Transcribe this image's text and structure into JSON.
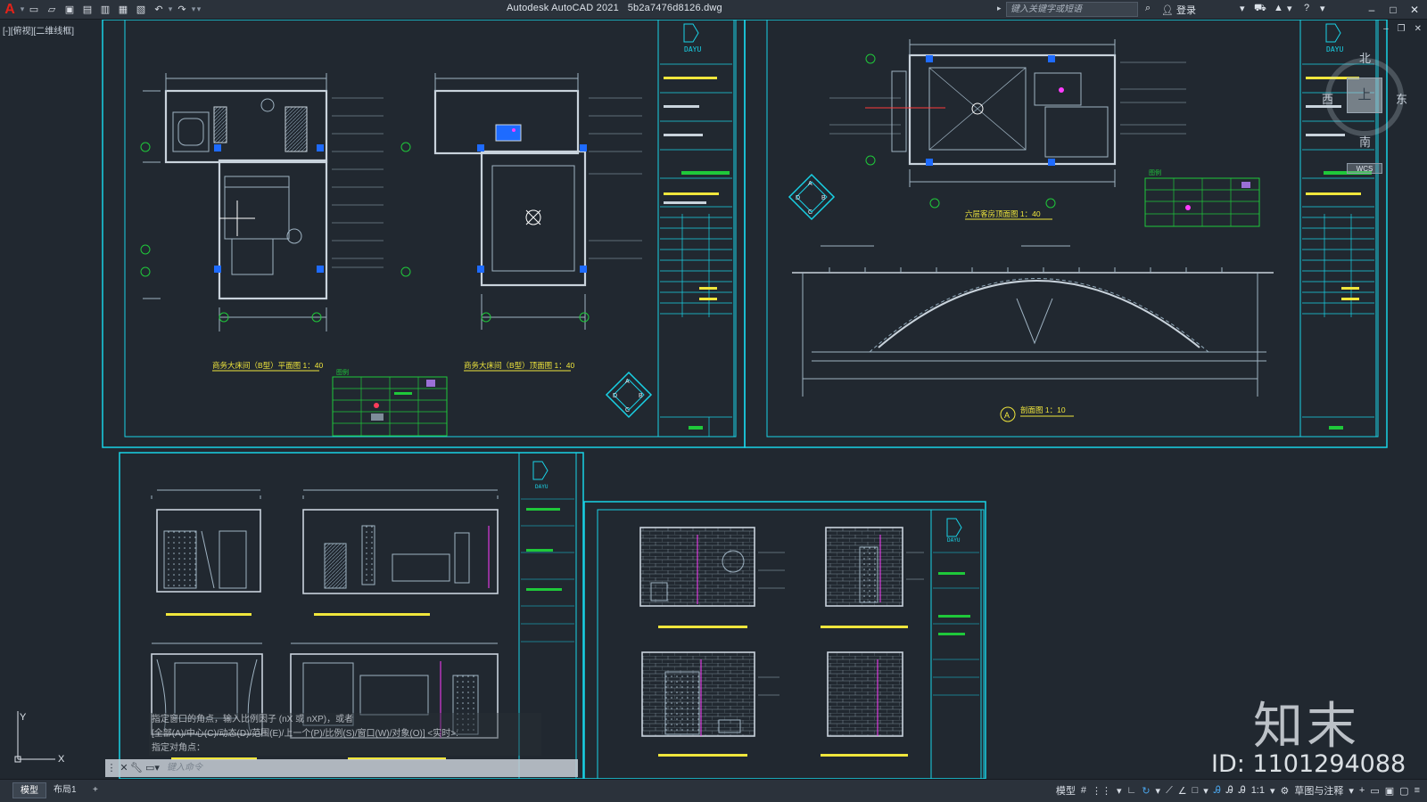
{
  "app": {
    "title": "Autodesk AutoCAD 2021",
    "filename": "5b2a7476d8126.dwg",
    "logo_letter": "A"
  },
  "search": {
    "placeholder": "键入关键字或短语"
  },
  "user": {
    "login_label": "登录"
  },
  "viewport": {
    "label": "[-][俯视][二维线框]"
  },
  "viewcube": {
    "face": "上",
    "north": "北",
    "south": "南",
    "east": "东",
    "west": "西",
    "wcs": "WCS"
  },
  "ucs": {
    "x": "X",
    "y": "Y"
  },
  "sheets": {
    "top_left": {
      "plan_title": "商务大床间（B型）平面图 1：40",
      "ceiling_title": "商务大床间（B型）顶面图 1：40",
      "legend_title": "图例",
      "firm": "DAYU"
    },
    "top_right": {
      "plan_title": "六层客房顶面图 1：40",
      "section_title": "剖面图 1：10",
      "section_marker": "A",
      "legend_title": "图例",
      "firm": "DAYU"
    },
    "bottom_left": {
      "firm": "DAYU"
    },
    "bottom_right": {
      "firm": "DAYU"
    }
  },
  "command": {
    "history": [
      "指定窗口的角点，输入比例因子 (nX 或 nXP)，或者",
      "[全部(A)/中心(C)/动态(D)/范围(E)/上一个(P)/比例(S)/窗口(W)/对象(O)] <实时>:",
      "指定对角点："
    ],
    "prompt": "键入命令"
  },
  "layout_tabs": [
    "模型",
    "布局1"
  ],
  "status": {
    "model_label": "模型",
    "scale": "1:1",
    "workspace": "草图与注释"
  },
  "watermark": {
    "logo": "知末",
    "id": "ID: 1101294088"
  },
  "colors": {
    "background": "#212830",
    "frame_cyan": "#19d2e6",
    "title_yellow": "#f0e63c",
    "legend_green": "#1fc83a",
    "accent_blue": "#1e6bff"
  }
}
